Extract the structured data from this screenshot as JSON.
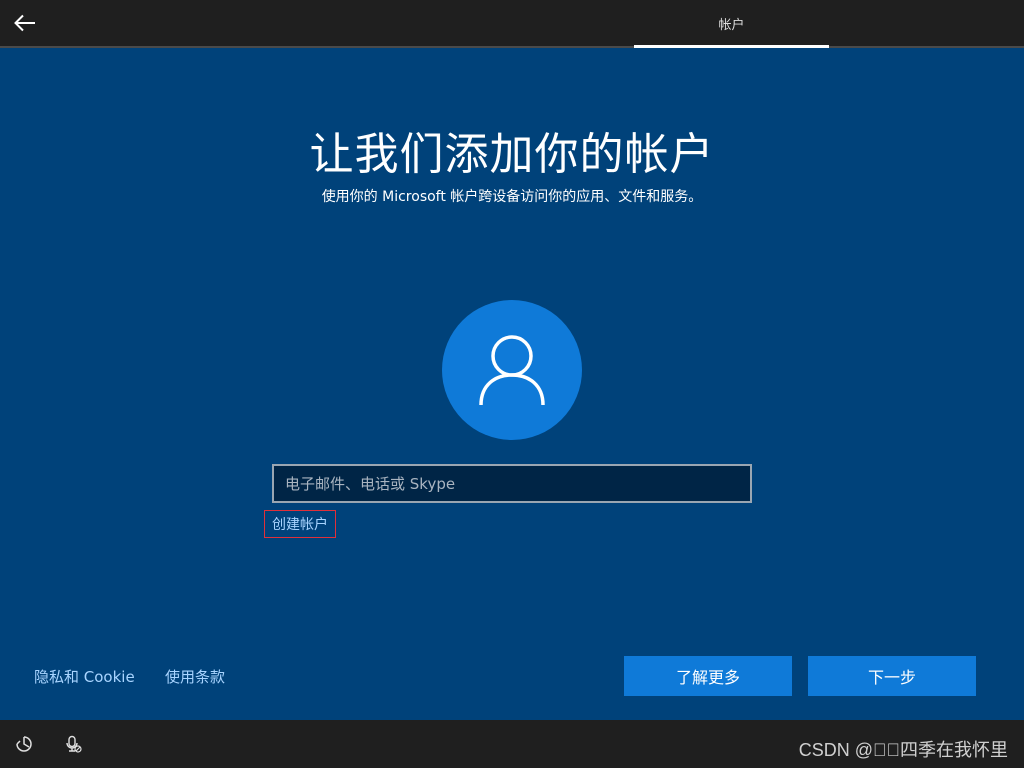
{
  "header": {
    "active_tab": "帐户"
  },
  "main": {
    "title": "让我们添加你的帐户",
    "subtitle": "使用你的 Microsoft 帐户跨设备访问你的应用、文件和服务。",
    "avatar_icon": "user-silhouette-icon",
    "input": {
      "placeholder": "电子邮件、电话或 Skype",
      "value": ""
    },
    "create_account_link": "创建帐户"
  },
  "footer": {
    "privacy_link": "隐私和 Cookie",
    "terms_link": "使用条款",
    "learn_more_button": "了解更多",
    "next_button": "下一步"
  },
  "bottom_bar": {
    "icons": [
      "ease-of-access-icon",
      "microphone-off-icon"
    ],
    "watermark": "CSDN @\u0000\u0000四季在我怀里"
  },
  "colors": {
    "background": "#00427a",
    "accent": "#0f7ad8",
    "bar": "#1f1f1f",
    "link": "#a8d4ff",
    "highlight_border": "#e0303a"
  }
}
